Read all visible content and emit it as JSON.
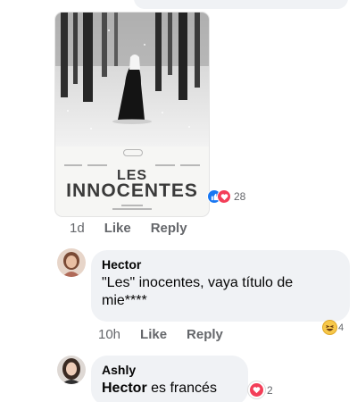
{
  "poster": {
    "title_line1": "LES",
    "title_line2": "INNOCENTES"
  },
  "post_reactions": {
    "count": "28",
    "icons": [
      "like-icon",
      "love-icon"
    ],
    "colors": {
      "like": "#1877f2",
      "love": "#f33e58"
    }
  },
  "post_meta": {
    "time": "1d",
    "like_label": "Like",
    "reply_label": "Reply"
  },
  "comments": [
    {
      "author": "Hector",
      "text": "\"Les\" inocentes, vaya título de mie****",
      "time": "10h",
      "like_label": "Like",
      "reply_label": "Reply",
      "reaction_icon": "haha-icon",
      "reaction_count": "4"
    },
    {
      "author": "Ashly",
      "mention": "Hector",
      "text": " es francés",
      "reaction_icon": "love-icon",
      "reaction_count": "2"
    }
  ]
}
